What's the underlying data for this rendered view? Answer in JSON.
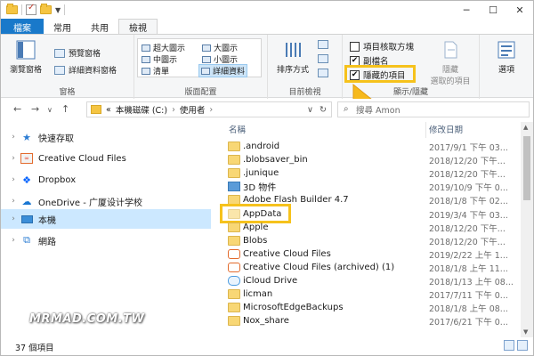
{
  "ribbon": {
    "tabs": [
      "檔案",
      "常用",
      "共用",
      "檢視"
    ],
    "groups": {
      "panes": {
        "label": "窗格",
        "preview_pane": "瀏覽窗格",
        "preview": "預覽窗格",
        "details_pane": "詳細資料窗格"
      },
      "layout": {
        "label": "版面配置",
        "items": [
          "超大圖示",
          "大圖示",
          "中圖示",
          "小圖示",
          "清單",
          "詳細資料"
        ],
        "selected": "詳細資料"
      },
      "current_view": {
        "label": "目前檢視",
        "sort_by": "排序方式"
      },
      "show_hide": {
        "label": "顯示/隱藏",
        "item_checkboxes": "項目核取方塊",
        "file_extensions": "副檔名",
        "hidden_items": "隱藏的項目",
        "hide_selected_line1": "隱藏",
        "hide_selected_line2": "選取的項目"
      },
      "options": {
        "label": "選項"
      }
    }
  },
  "address": {
    "path_prefix": "«",
    "segments": [
      "本機磁碟 (C:)",
      "使用者"
    ],
    "search_placeholder": "搜尋 Amon"
  },
  "navpane": {
    "items": [
      {
        "label": "快速存取",
        "icon": "star-icon"
      },
      {
        "label": "Creative Cloud Files",
        "icon": "creative-cloud-icon"
      },
      {
        "label": "Dropbox",
        "icon": "dropbox-icon"
      },
      {
        "label": "OneDrive - 广厦设计学校",
        "icon": "onedrive-icon"
      },
      {
        "label": "本機",
        "icon": "computer-icon"
      },
      {
        "label": "網路",
        "icon": "network-icon"
      }
    ],
    "selected": "本機"
  },
  "filelist": {
    "columns": {
      "name": "名稱",
      "date": "修改日期"
    },
    "rows": [
      {
        "name": ".android",
        "date": "2017/9/1 下午 03...",
        "icon": "folder"
      },
      {
        "name": ".blobsaver_bin",
        "date": "2018/12/20 下午...",
        "icon": "folder"
      },
      {
        "name": ".junique",
        "date": "2018/12/20 下午...",
        "icon": "folder"
      },
      {
        "name": "3D 物件",
        "date": "2019/10/9 下午 0...",
        "icon": "3d"
      },
      {
        "name": "Adobe Flash Builder 4.7",
        "date": "2018/1/8 下午 02...",
        "icon": "folder"
      },
      {
        "name": "AppData",
        "date": "2019/3/4 下午 03...",
        "icon": "folder-hidden"
      },
      {
        "name": "Apple",
        "date": "2018/12/20 下午...",
        "icon": "folder"
      },
      {
        "name": "Blobs",
        "date": "2018/12/20 下午...",
        "icon": "folder"
      },
      {
        "name": "Creative Cloud Files",
        "date": "2019/2/22 上午 1...",
        "icon": "cc"
      },
      {
        "name": "Creative Cloud Files (archived) (1)",
        "date": "2018/1/8 上午 11...",
        "icon": "cc"
      },
      {
        "name": "iCloud Drive",
        "date": "2018/1/13 上午 08...",
        "icon": "icloud"
      },
      {
        "name": "licman",
        "date": "2017/7/11 下午 0...",
        "icon": "folder"
      },
      {
        "name": "MicrosoftEdgeBackups",
        "date": "2018/1/8 上午 08...",
        "icon": "folder"
      },
      {
        "name": "Nox_share",
        "date": "2017/6/21 下午 0...",
        "icon": "folder"
      }
    ]
  },
  "status": {
    "count": "37 個項目"
  },
  "watermark": "MRMAD.COM.TW",
  "colors": {
    "file_tab": "#1979ca",
    "highlight": "#f6c21c",
    "selection": "#cce8ff"
  }
}
